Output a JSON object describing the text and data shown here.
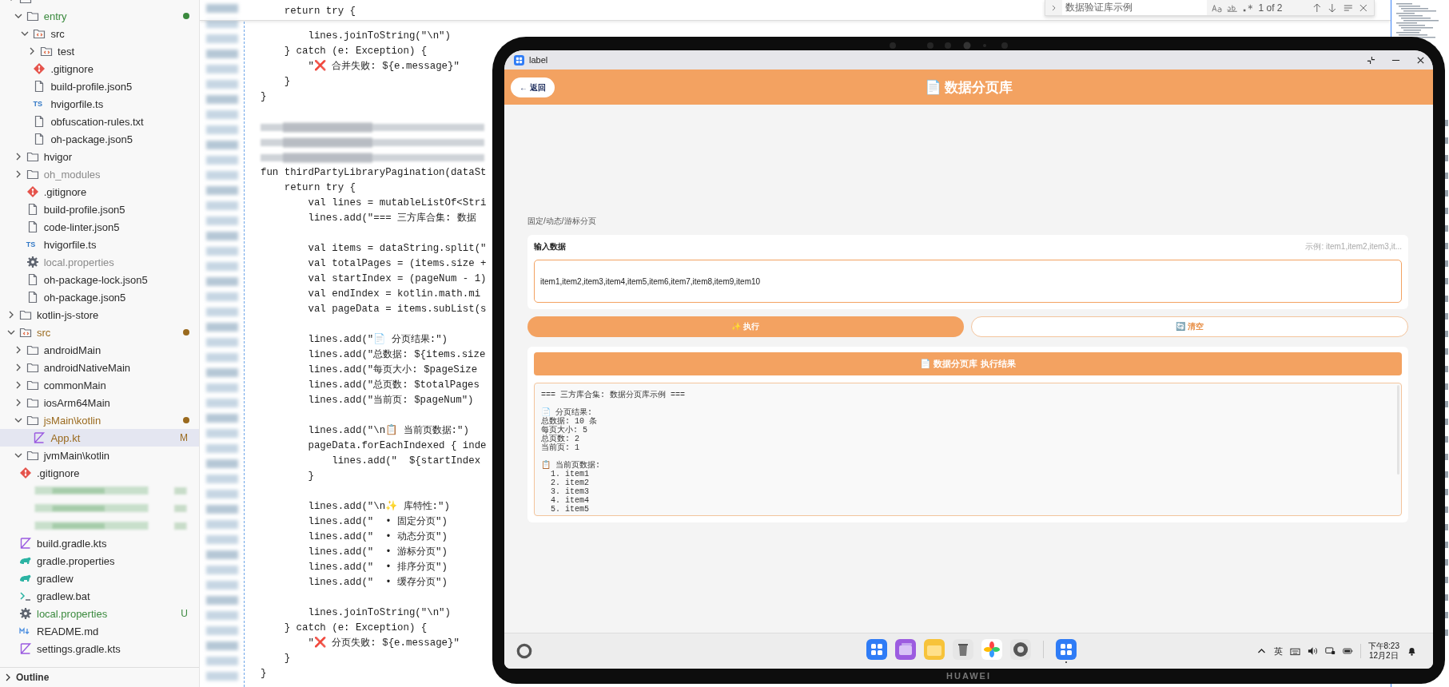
{
  "explorer": {
    "tree": [
      {
        "kind": "folder",
        "expanded": true,
        "selected": false,
        "children": [
          {
            "label": "entry",
            "kind": "folder",
            "expanded": true,
            "selected": false,
            "color": "#3b8a3e",
            "dot": true,
            "children": [
              {
                "label": "src",
                "kind": "source",
                "expanded": true,
                "selected": false,
                "children": [
                  {
                    "label": "test",
                    "kind": "source",
                    "expanded": false,
                    "selected": false
                  }
                ]
              },
              {
                "label": ".gitignore",
                "kind": "git",
                "selected": false
              },
              {
                "label": "build-profile.json5",
                "kind": "file",
                "selected": false
              },
              {
                "label": "hvigorfile.ts",
                "kind": "ts",
                "icon_text": "TS",
                "selected": false
              },
              {
                "label": "obfuscation-rules.txt",
                "kind": "file",
                "selected": false
              },
              {
                "label": "oh-package.json5",
                "kind": "file",
                "selected": false
              }
            ]
          },
          {
            "label": "hvigor",
            "kind": "folder",
            "expanded": false,
            "selected": false
          },
          {
            "label": "oh_modules",
            "kind": "folder",
            "expanded": false,
            "selected": false,
            "dimmed": true
          },
          {
            "label": ".gitignore",
            "kind": "git",
            "selected": false
          },
          {
            "label": "build-profile.json5",
            "kind": "file",
            "selected": false
          },
          {
            "label": "code-linter.json5",
            "kind": "file",
            "selected": false
          },
          {
            "label": "hvigorfile.ts",
            "kind": "ts",
            "icon_text": "TS",
            "selected": false
          },
          {
            "label": "local.properties",
            "kind": "gear",
            "selected": false,
            "dimmed": true
          },
          {
            "label": "oh-package-lock.json5",
            "kind": "file",
            "selected": false
          },
          {
            "label": "oh-package.json5",
            "kind": "file",
            "selected": false
          }
        ]
      },
      {
        "label": "kotlin-js-store",
        "kind": "folder",
        "expanded": false,
        "selected": false
      },
      {
        "label": "src",
        "kind": "source",
        "expanded": true,
        "selected": false,
        "color": "#9a6a1e",
        "dot": true,
        "children": [
          {
            "label": "androidMain",
            "kind": "folder",
            "expanded": false,
            "selected": false
          },
          {
            "label": "androidNativeMain",
            "kind": "folder",
            "expanded": false,
            "selected": false
          },
          {
            "label": "commonMain",
            "kind": "folder",
            "expanded": false,
            "selected": false
          },
          {
            "label": "iosArm64Main",
            "kind": "folder",
            "expanded": false,
            "selected": false
          },
          {
            "label": "jsMain\\kotlin",
            "kind": "folder",
            "expanded": true,
            "selected": false,
            "color": "#9a6a1e",
            "dot": true,
            "children": [
              {
                "label": "App.kt",
                "kind": "kotlin",
                "selected": true,
                "color": "#9a6a1e",
                "badge": "M"
              }
            ]
          },
          {
            "label": "jvmMain\\kotlin",
            "kind": "folder",
            "expanded": true,
            "selected": false
          }
        ]
      },
      {
        "label": ".gitignore",
        "kind": "git",
        "selected": false
      },
      {
        "kind": "redacted"
      },
      {
        "kind": "redacted"
      },
      {
        "kind": "redacted"
      },
      {
        "label": "build.gradle.kts",
        "kind": "kotlin",
        "selected": false
      },
      {
        "label": "gradle.properties",
        "kind": "gradle",
        "selected": false
      },
      {
        "label": "gradlew",
        "kind": "gradle",
        "selected": false
      },
      {
        "label": "gradlew.bat",
        "kind": "terminal",
        "selected": false
      },
      {
        "label": "local.properties",
        "kind": "gear",
        "selected": false,
        "color": "#3b8a3e",
        "badge": "U"
      },
      {
        "label": "README.md",
        "kind": "markdown",
        "selected": false
      },
      {
        "label": "settings.gradle.kts",
        "kind": "kotlin",
        "selected": false
      }
    ],
    "outline": {
      "label": "Outline",
      "expanded": false
    }
  },
  "editor": {
    "sticky_line": "    return try {",
    "lines": [
      {
        "kind": "blank"
      },
      {
        "kind": "code",
        "text": "        lines.joinToString(\"\\n\")"
      },
      {
        "kind": "code",
        "text": "    } catch (e: Exception) {"
      },
      {
        "kind": "code",
        "text": "        \"❌ 合并失败: ${e.message}\""
      },
      {
        "kind": "code",
        "text": "    }"
      },
      {
        "kind": "code",
        "text": "}"
      },
      {
        "kind": "blank"
      },
      {
        "kind": "redacted"
      },
      {
        "kind": "redacted"
      },
      {
        "kind": "redacted"
      },
      {
        "kind": "code",
        "text": "fun thirdPartyLibraryPagination(dataSt"
      },
      {
        "kind": "code",
        "text": "    return try {"
      },
      {
        "kind": "code",
        "text": "        val lines = mutableListOf<Stri"
      },
      {
        "kind": "code",
        "text": "        lines.add(\"=== 三方库合集: 数据"
      },
      {
        "kind": "blank"
      },
      {
        "kind": "code",
        "text": "        val items = dataString.split(\""
      },
      {
        "kind": "code",
        "text": "        val totalPages = (items.size +"
      },
      {
        "kind": "code",
        "text": "        val startIndex = (pageNum - 1)"
      },
      {
        "kind": "code",
        "text": "        val endIndex = kotlin.math.mi"
      },
      {
        "kind": "code",
        "text": "        val pageData = items.subList(s"
      },
      {
        "kind": "blank"
      },
      {
        "kind": "code",
        "text": "        lines.add(\"📄 分页结果:\")"
      },
      {
        "kind": "code",
        "text": "        lines.add(\"总数据: ${items.size"
      },
      {
        "kind": "code",
        "text": "        lines.add(\"每页大小: $pageSize"
      },
      {
        "kind": "code",
        "text": "        lines.add(\"总页数: $totalPages"
      },
      {
        "kind": "code",
        "text": "        lines.add(\"当前页: $pageNum\")"
      },
      {
        "kind": "blank"
      },
      {
        "kind": "code",
        "text": "        lines.add(\"\\n📋 当前页数据:\")"
      },
      {
        "kind": "code",
        "text": "        pageData.forEachIndexed { inde"
      },
      {
        "kind": "code",
        "text": "            lines.add(\"  ${startIndex"
      },
      {
        "kind": "code",
        "text": "        }"
      },
      {
        "kind": "blank"
      },
      {
        "kind": "code",
        "text": "        lines.add(\"\\n✨ 库特性:\")"
      },
      {
        "kind": "code",
        "text": "        lines.add(\"  • 固定分页\")"
      },
      {
        "kind": "code",
        "text": "        lines.add(\"  • 动态分页\")"
      },
      {
        "kind": "code",
        "text": "        lines.add(\"  • 游标分页\")"
      },
      {
        "kind": "code",
        "text": "        lines.add(\"  • 排序分页\")"
      },
      {
        "kind": "code",
        "text": "        lines.add(\"  • 缓存分页\")"
      },
      {
        "kind": "blank"
      },
      {
        "kind": "code",
        "text": "        lines.joinToString(\"\\n\")"
      },
      {
        "kind": "code",
        "text": "    } catch (e: Exception) {"
      },
      {
        "kind": "code",
        "text": "        \"❌ 分页失败: ${e.message}\""
      },
      {
        "kind": "code",
        "text": "    }"
      },
      {
        "kind": "code",
        "text": "}"
      }
    ]
  },
  "find_widget": {
    "value": "数据验证库示例",
    "match_count": "1 of 2"
  },
  "device": {
    "brand": "HUAWEI",
    "window_title": "label",
    "app": {
      "back": "← 返回",
      "title": "📄 数据分页库",
      "subtitle": "固定/动态/游标分页",
      "input": {
        "label": "输入数据",
        "hint": "示例: item1,item2,item3,it...",
        "value": "item1,item2,item3,item4,item5,item6,item7,item8,item9,item10"
      },
      "buttons": [
        {
          "kind": "primary",
          "label": "✨ 执行"
        },
        {
          "kind": "secondary",
          "label": "🔄 清空"
        }
      ],
      "result": {
        "title": "📄 数据分页库 执行结果",
        "blocks": [
          [
            "=== 三方库合集: 数据分页库示例 ==="
          ],
          [
            "📄 分页结果:",
            "总数据: 10 条",
            "每页大小: 5",
            "总页数: 2",
            "当前页: 1"
          ],
          [
            "📋 当前页数据:",
            "  1. item1",
            "  2. item2",
            "  3. item3",
            "  4. item4",
            "  5. item5"
          ]
        ]
      }
    },
    "taskbar": {
      "ime": "英",
      "time": "下午8:23",
      "date": "12月2日"
    }
  }
}
